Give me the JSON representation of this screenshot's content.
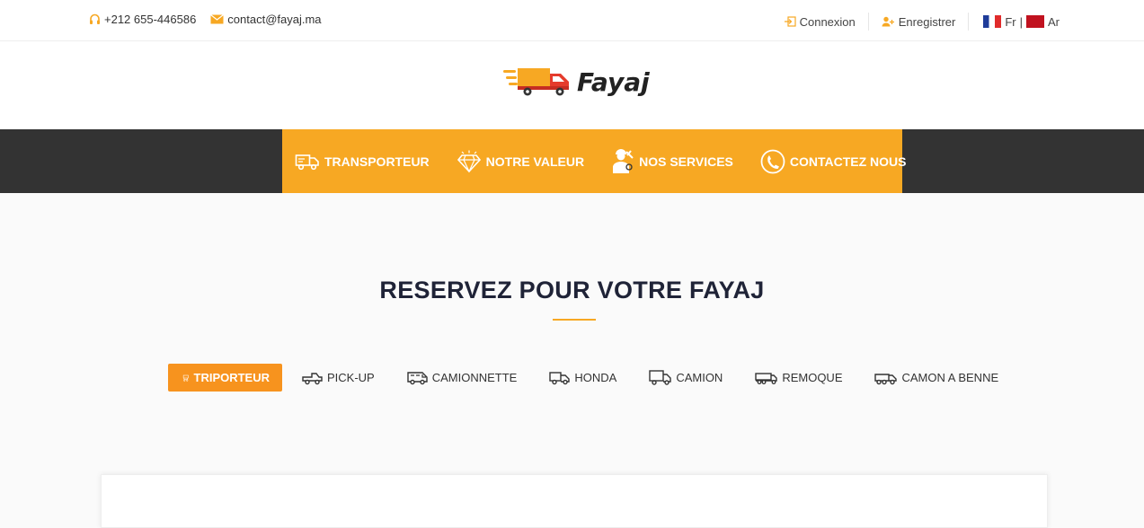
{
  "topbar": {
    "phone": "+212 655-446586",
    "email": "contact@fayaj.ma",
    "login": "Connexion",
    "register": "Enregistrer",
    "lang_fr": "Fr",
    "lang_sep": "|",
    "lang_ar": "Ar"
  },
  "logo": {
    "text": "Fayaj"
  },
  "nav": {
    "items": [
      {
        "label": "TRANSPORTEUR",
        "icon": "truck-icon"
      },
      {
        "label": "NOTRE VALEUR",
        "icon": "diamond-icon"
      },
      {
        "label": "NOS SERVICES",
        "icon": "worker-icon"
      },
      {
        "label": "CONTACTEZ NOUS",
        "icon": "phone-icon"
      }
    ]
  },
  "main": {
    "title": "RESERVEZ POUR VOTRE FAYAJ",
    "tabs": [
      {
        "label": "TRIPORTEUR",
        "icon": "tricycle-icon",
        "active": true
      },
      {
        "label": "PICK-UP",
        "icon": "pickup-icon"
      },
      {
        "label": "CAMIONNETTE",
        "icon": "van-icon"
      },
      {
        "label": "HONDA",
        "icon": "small-truck-icon"
      },
      {
        "label": "CAMION",
        "icon": "truck-icon"
      },
      {
        "label": "REMOQUE",
        "icon": "trailer-icon"
      },
      {
        "label": "CAMON A BENNE",
        "icon": "dump-truck-icon"
      }
    ]
  },
  "colors": {
    "accent": "#f7a823",
    "nav_bg": "#333333",
    "title": "#1f2337"
  }
}
